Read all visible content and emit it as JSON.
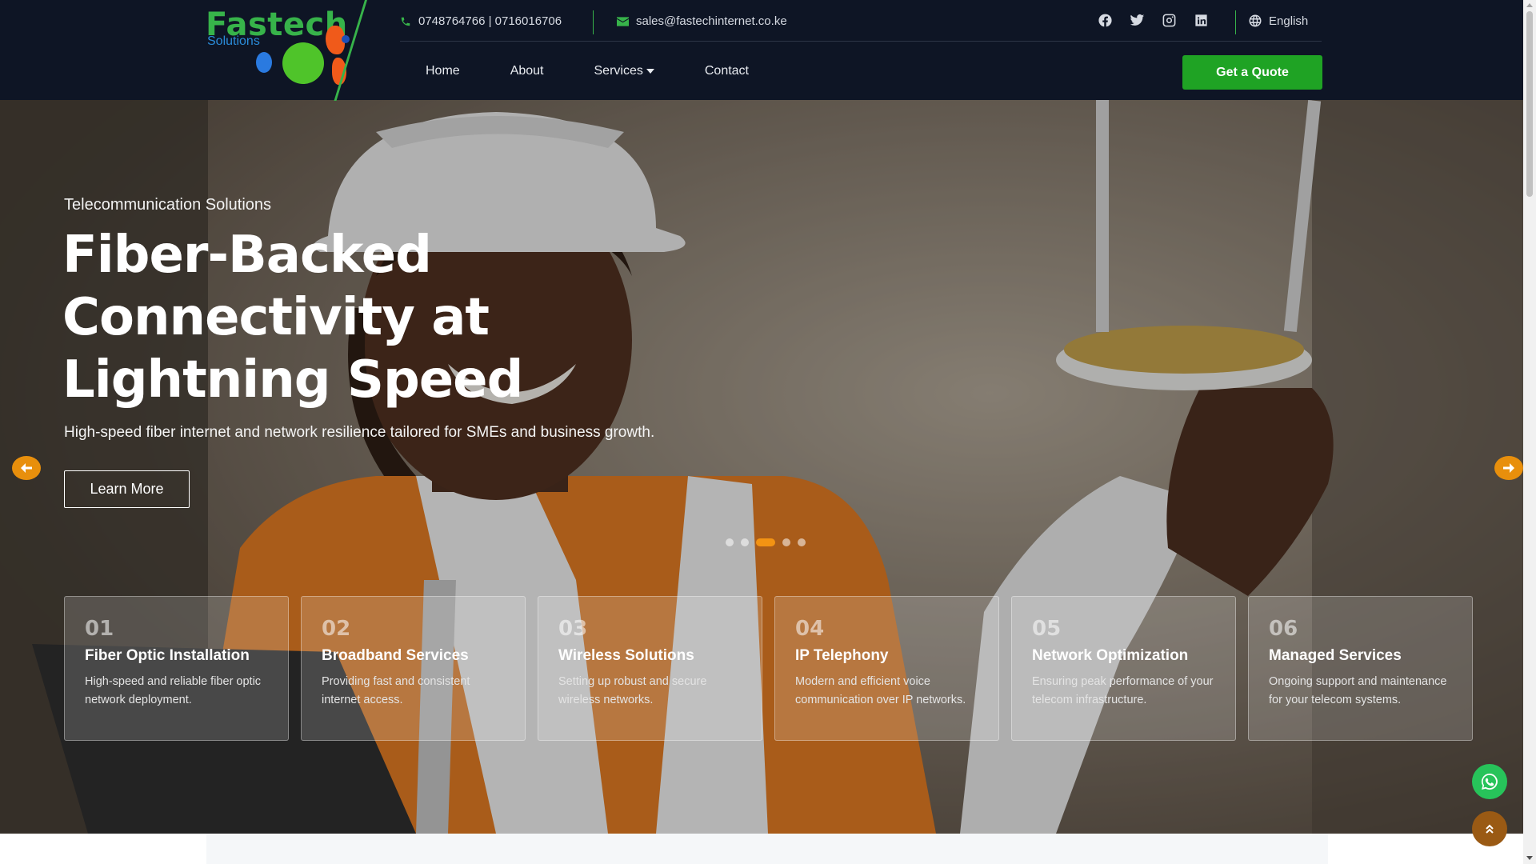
{
  "brand": {
    "name": "Fastech",
    "tagline": "Solutions"
  },
  "contact": {
    "phone": "0748764766 | 0716016706",
    "email": "sales@fastechinternet.co.ke"
  },
  "socials": [
    "facebook-icon",
    "twitter-icon",
    "instagram-icon",
    "linkedin-icon"
  ],
  "language": {
    "label": "English"
  },
  "nav": {
    "home": "Home",
    "about": "About",
    "services": "Services",
    "contact": "Contact"
  },
  "cta": {
    "quote": "Get a Quote"
  },
  "hero": {
    "eyebrow": "Telecommunication Solutions",
    "headline": "Fiber-Backed Connectivity at Lightning Speed",
    "subtext": "High-speed fiber internet and network resilience tailored for SMEs and business growth.",
    "button": "Learn More",
    "slide_count": 5,
    "active_slide": 3
  },
  "services": [
    {
      "num": "01",
      "title": "Fiber Optic Installation",
      "desc": "High-speed and reliable fiber optic network deployment."
    },
    {
      "num": "02",
      "title": "Broadband Services",
      "desc": "Providing fast and consistent internet access."
    },
    {
      "num": "03",
      "title": "Wireless Solutions",
      "desc": "Setting up robust and secure wireless networks."
    },
    {
      "num": "04",
      "title": "IP Telephony",
      "desc": "Modern and efficient voice communication over IP networks."
    },
    {
      "num": "05",
      "title": "Network Optimization",
      "desc": "Ensuring peak performance of your telecom infrastructure."
    },
    {
      "num": "06",
      "title": "Managed Services",
      "desc": "Ongoing support and maintenance for your telecom systems."
    }
  ],
  "colors": {
    "header": "#0e1525",
    "accent_green": "#1fa324",
    "accent_orange": "#f39313",
    "whatsapp": "#27c35a"
  }
}
